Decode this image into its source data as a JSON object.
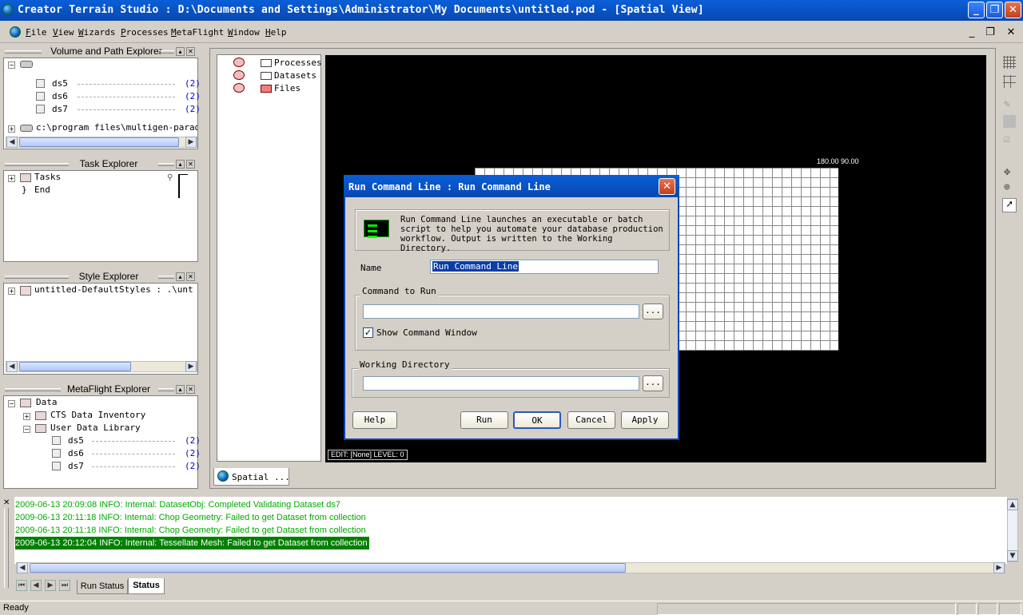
{
  "window": {
    "title": "Creator Terrain Studio : D:\\Documents and Settings\\Administrator\\My Documents\\untitled.pod - [Spatial View]"
  },
  "menu": [
    "File",
    "View",
    "Wizards",
    "Processes",
    "MetaFlight",
    "Window",
    "Help"
  ],
  "volume_explorer": {
    "title": "Volume and Path Explorer",
    "items": [
      {
        "label": "ds5",
        "count": "(2)"
      },
      {
        "label": "ds6",
        "count": "(2)"
      },
      {
        "label": "ds7",
        "count": "(2)"
      }
    ],
    "path": "c:\\program files\\multigen-paradigm"
  },
  "task_explorer": {
    "title": "Task Explorer",
    "tasks": "Tasks",
    "end": "End"
  },
  "style_explorer": {
    "title": "Style Explorer",
    "item": "untitled-DefaultStyles : .\\unt..."
  },
  "metaflight_explorer": {
    "title": "MetaFlight Explorer",
    "data": "Data",
    "inventory": "CTS Data Inventory",
    "library": "User Data Library",
    "items": [
      {
        "label": "ds5",
        "count": "(2)"
      },
      {
        "label": "ds6",
        "count": "(2)"
      },
      {
        "label": "ds7",
        "count": "(2)"
      }
    ]
  },
  "project_tree": [
    "Processes",
    "Datasets",
    "Files"
  ],
  "spatial": {
    "coord": "180.00 90.00",
    "edit_status": "EDIT: [None] LEVEL: 0",
    "tab": "Spatial ..."
  },
  "dialog": {
    "title": "Run Command Line : Run Command Line",
    "description": "Run Command Line launches an executable or batch script to help you automate your database production workflow. Output is written to the Working Directory.",
    "name_label": "Name",
    "name_value": "Run Command Line",
    "command_group": "Command to Run",
    "command_value": "",
    "browse": "...",
    "show_window": "Show Command Window",
    "working_dir_group": "Working Directory",
    "working_dir_value": "",
    "help": "Help",
    "run": "Run",
    "ok": "OK",
    "cancel": "Cancel",
    "apply": "Apply"
  },
  "log": [
    "2009-06-13 20:09:08 INFO: Internal: DatasetObj: Completed Validating Dataset ds7",
    "2009-06-13 20:11:18 INFO: Internal: Chop Geometry: Failed to get Dataset from collection",
    "2009-06-13 20:11:18 INFO: Internal: Chop Geometry: Failed to get Dataset from collection",
    "2009-06-13 20:12:04 INFO: Internal: Tessellate Mesh: Failed to get Dataset from collection"
  ],
  "log_tabs": [
    "Run Status",
    "Status"
  ],
  "status": "Ready",
  "colors": {
    "titlebar": "#0a5fd8",
    "log_text": "#00aa00",
    "log_selected_bg": "#008000"
  }
}
